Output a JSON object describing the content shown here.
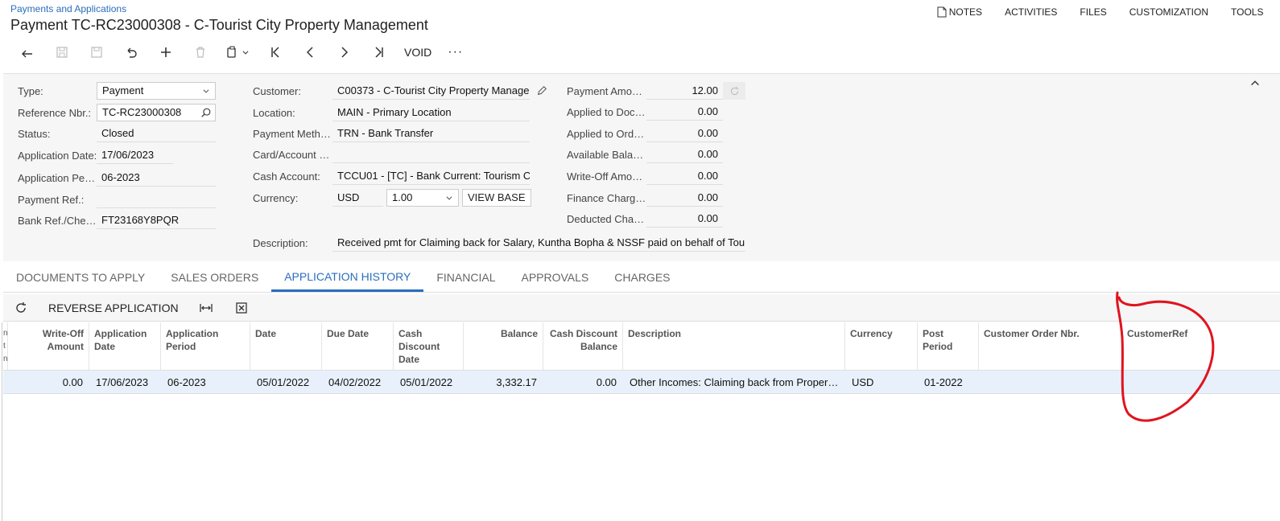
{
  "header": {
    "breadcrumb": "Payments and Applications",
    "title": "Payment TC-RC23000308 - C-Tourist City Property Management"
  },
  "top_menu": {
    "notes": "NOTES",
    "activities": "ACTIVITIES",
    "files": "FILES",
    "customization": "CUSTOMIZATION",
    "tools": "TOOLS"
  },
  "toolbar": {
    "void_label": "VOID",
    "more_label": "···"
  },
  "form": {
    "type": {
      "label": "Type:",
      "value": "Payment"
    },
    "reference_nbr": {
      "label": "Reference Nbr.:",
      "value": "TC-RC23000308"
    },
    "status": {
      "label": "Status:",
      "value": "Closed"
    },
    "application_date": {
      "label": "Application Date:",
      "value": "17/06/2023"
    },
    "application_period": {
      "label": "Application Pe…",
      "value": "06-2023"
    },
    "payment_ref": {
      "label": "Payment Ref.:",
      "value": ""
    },
    "bank_ref": {
      "label": "Bank Ref./Che…",
      "value": "FT23168Y8PQR"
    },
    "customer": {
      "label": "Customer:",
      "value": "C00373 - C-Tourist City Property Manage"
    },
    "location": {
      "label": "Location:",
      "value": "MAIN - Primary Location"
    },
    "payment_method": {
      "label": "Payment Meth…",
      "value": "TRN - Bank Transfer"
    },
    "card_account": {
      "label": "Card/Account …",
      "value": ""
    },
    "cash_account": {
      "label": "Cash Account:",
      "value": "TCCU01 - [TC] - Bank Current: Tourism C"
    },
    "currency": {
      "label": "Currency:",
      "value": "USD",
      "rate": "1.00",
      "view_base": "VIEW BASE"
    },
    "description": {
      "label": "Description:",
      "value": "Received pmt for Claiming back for Salary, Kuntha Bopha & NSSF paid on behalf of Tour"
    },
    "payment_amount": {
      "label": "Payment Amo…",
      "value": "12.00"
    },
    "applied_to_doc": {
      "label": "Applied to Doc…",
      "value": "0.00"
    },
    "applied_to_ord": {
      "label": "Applied to Ord…",
      "value": "0.00"
    },
    "available_bal": {
      "label": "Available Bala…",
      "value": "0.00"
    },
    "write_off_amount": {
      "label": "Write-Off Amo…",
      "value": "0.00"
    },
    "finance_charges": {
      "label": "Finance Charg…",
      "value": "0.00"
    },
    "deducted_charges": {
      "label": "Deducted Cha…",
      "value": "0.00"
    }
  },
  "tabs": [
    {
      "label": "DOCUMENTS TO APPLY"
    },
    {
      "label": "SALES ORDERS"
    },
    {
      "label": "APPLICATION HISTORY"
    },
    {
      "label": "FINANCIAL"
    },
    {
      "label": "APPROVALS"
    },
    {
      "label": "CHARGES"
    }
  ],
  "grid_toolbar": {
    "reverse_application": "REVERSE APPLICATION"
  },
  "grid": {
    "columns": [
      {
        "label": "n t n"
      },
      {
        "label": "Write-Off Amount"
      },
      {
        "label": "Application Date"
      },
      {
        "label": "Application Period"
      },
      {
        "label": "Date"
      },
      {
        "label": "Due Date"
      },
      {
        "label": "Cash Discount Date"
      },
      {
        "label": "Balance"
      },
      {
        "label": "Cash Discount Balance"
      },
      {
        "label": "Description"
      },
      {
        "label": "Currency"
      },
      {
        "label": "Post Period"
      },
      {
        "label": "Customer Order Nbr."
      },
      {
        "label": "CustomerRef"
      }
    ],
    "rows": [
      {
        "write_off": "0.00",
        "application_date": "17/06/2023",
        "application_period": "06-2023",
        "date": "05/01/2022",
        "due_date": "04/02/2022",
        "cash_discount_date": "05/01/2022",
        "balance": "3,332.17",
        "cash_discount_balance": "0.00",
        "description": "Other Incomes: Claiming back from Propert…",
        "currency": "USD",
        "post_period": "01-2022",
        "customer_order_nbr": "",
        "customer_ref": ""
      }
    ]
  },
  "colors": {
    "accent": "#2a6ebb",
    "selected_row": "#e8f1fb",
    "annotation": "#e0141e"
  }
}
